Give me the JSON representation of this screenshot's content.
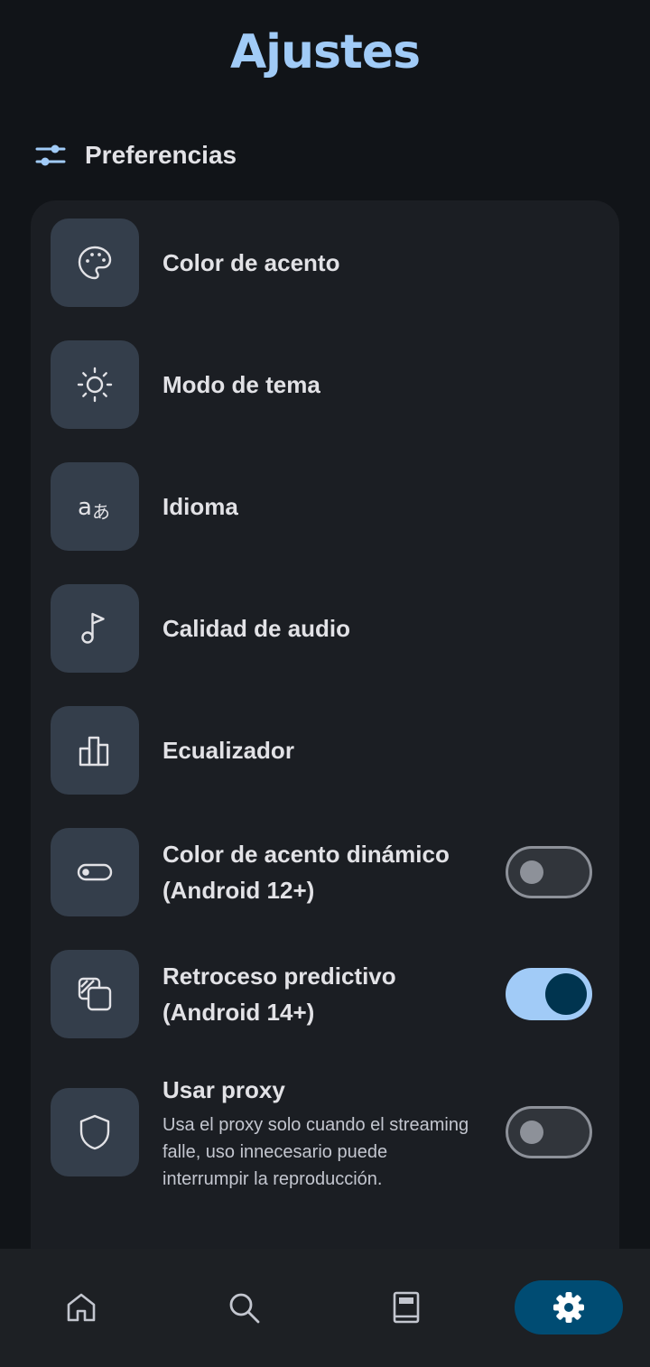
{
  "header": {
    "title": "Ajustes"
  },
  "section": {
    "label": "Preferencias",
    "icon": "tune-icon"
  },
  "items": [
    {
      "title": "Color de acento",
      "icon": "palette-icon"
    },
    {
      "title": "Modo de tema",
      "icon": "sun-icon"
    },
    {
      "title": "Idioma",
      "icon": "translate-icon"
    },
    {
      "title": "Calidad de audio",
      "icon": "music-note-icon"
    },
    {
      "title": "Ecualizador",
      "icon": "bar-chart-icon"
    },
    {
      "title_line1": "Color de acento dinámico",
      "title_line2": "(Android 12+)",
      "icon": "toggle-icon",
      "toggle": false
    },
    {
      "title_line1": "Retroceso predictivo",
      "title_line2": "(Android 14+)",
      "icon": "layers-icon",
      "toggle": true
    },
    {
      "title": "Usar proxy",
      "subtitle": "Usa el proxy solo cuando el streaming falle, uso innecesario puede interrumpir la reproducción.",
      "icon": "shield-icon",
      "toggle": false
    }
  ],
  "nav": [
    {
      "name": "home",
      "icon": "home-icon",
      "active": false
    },
    {
      "name": "search",
      "icon": "search-icon",
      "active": false
    },
    {
      "name": "library",
      "icon": "library-icon",
      "active": false
    },
    {
      "name": "settings",
      "icon": "settings-gear-icon",
      "active": true
    }
  ],
  "colors": {
    "accent": "#a1cbf7",
    "background": "#111418",
    "card": "#1b1e23",
    "icon_box": "#343e4b",
    "nav_active": "#004c73"
  }
}
